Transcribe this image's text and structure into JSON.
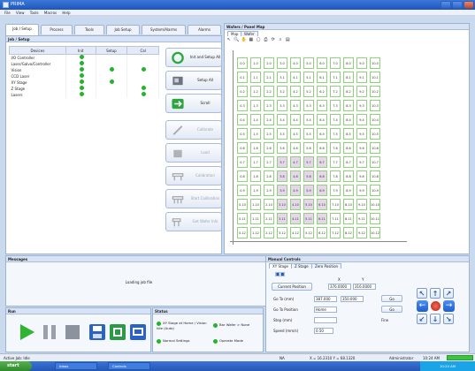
{
  "window": {
    "title": "PRIMA"
  },
  "menu": [
    "File",
    "View",
    "Tools",
    "Macros",
    "Help"
  ],
  "left_tabs": [
    "Job / Setup",
    "Process",
    "Tools",
    "Job Setup",
    "System/Alarms",
    "Alarms"
  ],
  "setup_panel": {
    "title": "Job / Setup"
  },
  "device_table": {
    "headers": [
      "Devices",
      "Init",
      "Setup",
      "Cal"
    ],
    "rows": [
      {
        "name": "I/O Controller",
        "init": true,
        "setup": false,
        "cal": false
      },
      {
        "name": "Laser/Galvo/Controller",
        "init": true,
        "setup": false,
        "cal": false
      },
      {
        "name": "Vision",
        "init": true,
        "setup": true,
        "cal": true
      },
      {
        "name": "CCD Laser",
        "init": true,
        "setup": false,
        "cal": false
      },
      {
        "name": "XY Stage",
        "init": true,
        "setup": true,
        "cal": false
      },
      {
        "name": "Z Stage",
        "init": true,
        "setup": false,
        "cal": true
      },
      {
        "name": "Lasers",
        "init": true,
        "setup": false,
        "cal": true
      }
    ]
  },
  "action_buttons": [
    {
      "label": "Init and Setup All",
      "icon": "init-circle-icon",
      "enabled": true
    },
    {
      "label": "Setup All",
      "icon": "setup-machine-icon",
      "enabled": true
    },
    {
      "label": "Scroll",
      "icon": "scroll-icon",
      "enabled": true
    },
    {
      "label": "Calibrate",
      "icon": "calibrate-icon",
      "enabled": false
    },
    {
      "label": "Load",
      "icon": "load-icon",
      "enabled": false
    },
    {
      "label": "Calibration",
      "icon": "calibration-icon",
      "enabled": false
    },
    {
      "label": "Start Calibration",
      "icon": "start-calibration-icon",
      "enabled": false
    },
    {
      "label": "Get Wafer Info",
      "icon": "wafer-info-icon",
      "enabled": false
    }
  ],
  "map_panel": {
    "title": "Wafers / Panel Map",
    "tabs": [
      "Map",
      "Wafer"
    ],
    "rows": [
      [
        "0.0",
        "1.0",
        "2.0",
        "3.0",
        "4.0",
        "5.0",
        "6.0",
        "7.0",
        "8.0",
        "9.0",
        "10.0"
      ],
      [
        "0.1",
        "1.1",
        "2.1",
        "3.1",
        "4.1",
        "5.1",
        "6.1",
        "7.1",
        "8.1",
        "9.1",
        "10.1"
      ],
      [
        "0.2",
        "1.2",
        "2.2",
        "3.2",
        "4.2",
        "5.2",
        "6.2",
        "7.2",
        "8.2",
        "9.2",
        "10.2"
      ],
      [
        "0.3",
        "1.3",
        "2.3",
        "3.3",
        "4.3",
        "5.3",
        "6.3",
        "7.3",
        "8.3",
        "9.3",
        "10.3"
      ],
      [
        "0.4",
        "1.4",
        "2.4",
        "3.4",
        "4.4",
        "5.4",
        "6.4",
        "7.4",
        "8.4",
        "9.4",
        "10.4"
      ],
      [
        "0.5",
        "1.5",
        "2.5",
        "3.5",
        "4.5",
        "5.5",
        "6.5",
        "7.5",
        "8.5",
        "9.5",
        "10.5"
      ],
      [
        "0.6",
        "1.6",
        "2.6",
        "3.6",
        "4.6",
        "5.6",
        "6.6",
        "7.6",
        "8.6",
        "9.6",
        "10.6"
      ],
      [
        "0.7",
        "1.7",
        "2.7",
        "3.7",
        "4.7",
        "5.7",
        "6.7",
        "7.7",
        "8.7",
        "9.7",
        "10.7"
      ],
      [
        "0.8",
        "1.8",
        "2.8",
        "3.8",
        "4.8",
        "5.8",
        "6.8",
        "7.8",
        "8.8",
        "9.8",
        "10.8"
      ],
      [
        "0.9",
        "1.9",
        "2.9",
        "3.9",
        "4.9",
        "5.9",
        "6.9",
        "7.9",
        "8.9",
        "9.9",
        "10.9"
      ],
      [
        "0.10",
        "1.10",
        "2.10",
        "3.10",
        "4.10",
        "5.10",
        "6.10",
        "7.10",
        "8.10",
        "9.10",
        "10.10"
      ],
      [
        "0.11",
        "1.11",
        "2.11",
        "3.11",
        "4.11",
        "5.11",
        "6.11",
        "7.11",
        "8.11",
        "9.11",
        "10.11"
      ],
      [
        "0.12",
        "1.12",
        "2.12",
        "3.12",
        "4.12",
        "5.12",
        "6.12",
        "7.12",
        "8.12",
        "9.12",
        "10.12"
      ]
    ]
  },
  "messages": {
    "title": "Messages",
    "text": "Loading job file"
  },
  "manual": {
    "title": "Manual Controls",
    "tabs": [
      "XY Stage",
      "Z Stage",
      "Zero Position"
    ],
    "col_x": "X",
    "col_y": "Y",
    "current_position_label": "Current Position",
    "current_x": "376.0000",
    "current_y": "316.0000",
    "rows": [
      {
        "label": "Go To (mm)",
        "x": "387.000",
        "y": "350.000",
        "btn": "Go"
      },
      {
        "label": "Go To Position",
        "x": "Home",
        "y": "",
        "btn": "Go"
      },
      {
        "label": "Step (mm)",
        "x": "",
        "y": "",
        "btn": ""
      },
      {
        "label": "Speed (mm/s)",
        "x": "0.50",
        "y": "",
        "btn": ""
      }
    ],
    "jog_label": "Fine"
  },
  "run": {
    "title": "Run"
  },
  "status": {
    "title": "Status",
    "items": [
      "XY Stage at Home / Vision Idle (Auto)",
      "Bar Wafer > None",
      "Normal Settings",
      "Operate Mode"
    ]
  },
  "statusbar": {
    "left": "Active Job: Idle",
    "mid": "NA",
    "coords": "X = 16.2310  Y = 68.1320",
    "user": "Administrator",
    "time": "10:24 AM"
  },
  "taskbar": {
    "start": "start",
    "items": [
      "Inbox",
      "Controls"
    ],
    "clock": "10:24 AM"
  }
}
